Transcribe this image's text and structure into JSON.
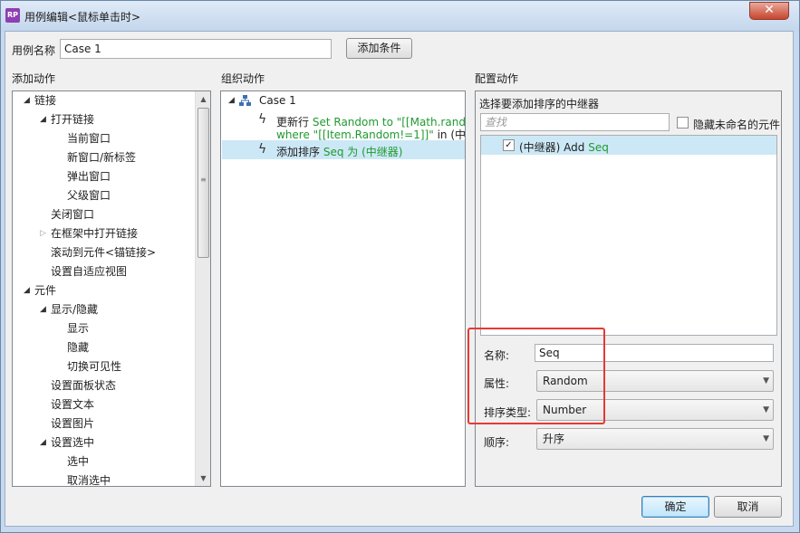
{
  "window": {
    "title": "用例编辑<鼠标单击时>",
    "app_icon_text": "RP",
    "close_label": "✕"
  },
  "case_name": {
    "label": "用例名称",
    "value": "Case 1"
  },
  "add_condition_label": "添加条件",
  "sections": {
    "add_action": "添加动作",
    "organize_action": "组织动作",
    "configure_action": "配置动作"
  },
  "tree": [
    {
      "label": "链接",
      "indent": 0,
      "state": "expanded"
    },
    {
      "label": "打开链接",
      "indent": 1,
      "state": "expanded"
    },
    {
      "label": "当前窗口",
      "indent": 2,
      "state": "leaf"
    },
    {
      "label": "新窗口/新标签",
      "indent": 2,
      "state": "leaf"
    },
    {
      "label": "弹出窗口",
      "indent": 2,
      "state": "leaf"
    },
    {
      "label": "父级窗口",
      "indent": 2,
      "state": "leaf"
    },
    {
      "label": "关闭窗口",
      "indent": 1,
      "state": "leaf"
    },
    {
      "label": "在框架中打开链接",
      "indent": 1,
      "state": "collapsed"
    },
    {
      "label": "滚动到元件<锚链接>",
      "indent": 1,
      "state": "leaf"
    },
    {
      "label": "设置自适应视图",
      "indent": 1,
      "state": "leaf"
    },
    {
      "label": "元件",
      "indent": 0,
      "state": "expanded"
    },
    {
      "label": "显示/隐藏",
      "indent": 1,
      "state": "expanded"
    },
    {
      "label": "显示",
      "indent": 2,
      "state": "leaf"
    },
    {
      "label": "隐藏",
      "indent": 2,
      "state": "leaf"
    },
    {
      "label": "切换可见性",
      "indent": 2,
      "state": "leaf"
    },
    {
      "label": "设置面板状态",
      "indent": 1,
      "state": "leaf"
    },
    {
      "label": "设置文本",
      "indent": 1,
      "state": "leaf"
    },
    {
      "label": "设置图片",
      "indent": 1,
      "state": "leaf"
    },
    {
      "label": "设置选中",
      "indent": 1,
      "state": "expanded"
    },
    {
      "label": "选中",
      "indent": 2,
      "state": "leaf"
    },
    {
      "label": "取消选中",
      "indent": 2,
      "state": "leaf"
    }
  ],
  "organize": {
    "case_label": "Case 1",
    "action1": {
      "verb": "更新行",
      "detail_line1": "Set Random to \"[[Math.random()]]\"",
      "detail_line2": "where \"[[Item.Random!=1]]\"",
      "suffix": "in (中继器)"
    },
    "action2": {
      "verb": "添加排序",
      "detail": "Seq 为",
      "suffix": "(中继器)"
    }
  },
  "configure": {
    "header": "选择要添加排序的中继器",
    "search_placeholder": "查找",
    "hide_unnamed_label": "隐藏未命名的元件",
    "repeater_item": {
      "prefix": "(中继器) Add",
      "name": "Seq",
      "checked": "✓"
    },
    "name_label": "名称:",
    "name_value": "Seq",
    "property_label": "属性:",
    "property_value": "Random",
    "sort_type_label": "排序类型:",
    "sort_type_value": "Number",
    "order_label": "顺序:",
    "order_value": "升序"
  },
  "footer": {
    "ok_label": "确定",
    "cancel_label": "取消"
  },
  "colors": {
    "accent_green": "#1f9a2f",
    "highlight_red": "#e53935",
    "selection_blue": "#cce8f6"
  }
}
